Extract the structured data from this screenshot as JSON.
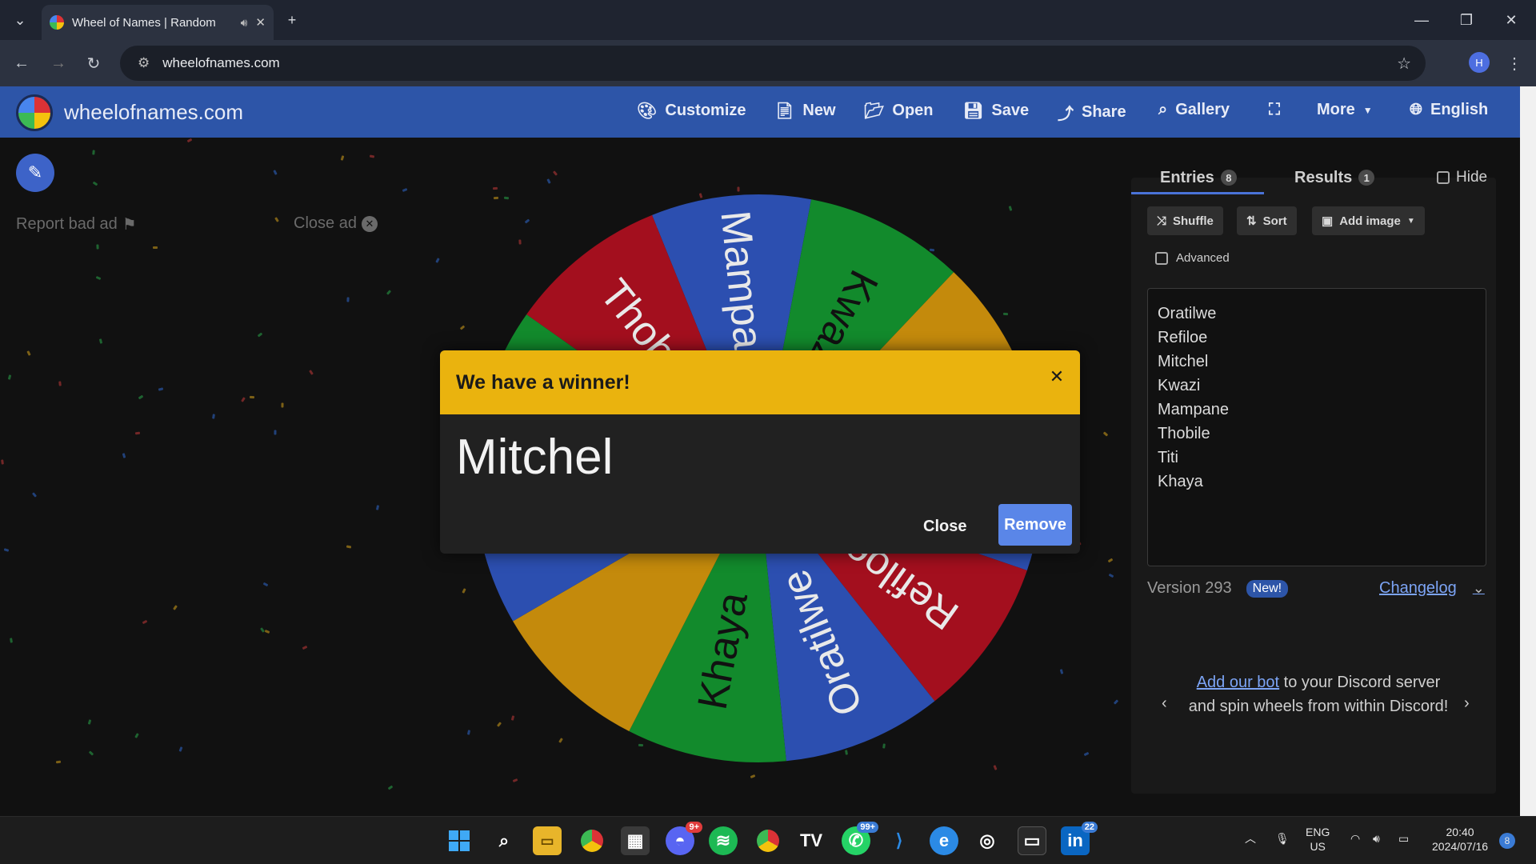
{
  "browser": {
    "tab_title": "Wheel of Names | Random",
    "url": "wheelofnames.com",
    "profile_initial": "H"
  },
  "app": {
    "brand": "wheelofnames.com",
    "menu": [
      {
        "label": "Customize",
        "icon": "palette-icon"
      },
      {
        "label": "New",
        "icon": "file-icon"
      },
      {
        "label": "Open",
        "icon": "folder-icon"
      },
      {
        "label": "Save",
        "icon": "floppy-icon"
      },
      {
        "label": "Share",
        "icon": "share-icon"
      },
      {
        "label": "Gallery",
        "icon": "search-icon"
      },
      {
        "label": "",
        "icon": "fullscreen-icon"
      },
      {
        "label": "More",
        "icon": "caret-down-icon"
      },
      {
        "label": "English",
        "icon": "globe-icon"
      }
    ]
  },
  "ad": {
    "report": "Report bad ad",
    "close": "Close ad"
  },
  "wheel": {
    "slices": [
      {
        "name": "Mampane",
        "color": "#2c4fb0"
      },
      {
        "name": "Kwazi",
        "color": "#128a2c"
      },
      {
        "name": "",
        "color": "#c48a0c"
      },
      {
        "name": "",
        "color": "#2c4fb0"
      },
      {
        "name": "Refiloe",
        "color": "#a30f1e"
      },
      {
        "name": "Oratilwe",
        "color": "#2c4fb0"
      },
      {
        "name": "Khaya",
        "color": "#128a2c"
      },
      {
        "name": "",
        "color": "#c48a0c"
      },
      {
        "name": "",
        "color": "#2c4fb0"
      },
      {
        "name": "",
        "color": "#128a2c"
      },
      {
        "name": "Thobile",
        "color": "#a30f1e"
      }
    ]
  },
  "panel": {
    "tabs": [
      {
        "label": "Entries",
        "count": "8"
      },
      {
        "label": "Results",
        "count": "1"
      }
    ],
    "hide_label": "Hide",
    "tools": [
      "Shuffle",
      "Sort",
      "Add image"
    ],
    "advanced_label": "Advanced",
    "entries": [
      "Oratilwe",
      "Refiloe",
      "Mitchel",
      "Kwazi",
      "Mampane",
      "Thobile",
      "Titi",
      "Khaya"
    ],
    "version": "Version 293",
    "new_badge": "New!",
    "changelog": "Changelog",
    "discord_link": "Add our bot",
    "discord_text": " to your Discord server and spin wheels from within Discord!"
  },
  "modal": {
    "title": "We have a winner!",
    "winner": "Mitchel",
    "close_label": "Close",
    "remove_label": "Remove"
  },
  "taskbar": {
    "badges": {
      "discord": "9+",
      "whatsapp": "99+",
      "linkedin": "22",
      "notifications": "8"
    },
    "lang": "ENG",
    "region": "US",
    "time": "20:40",
    "date": "2024/07/16"
  },
  "colors": {
    "appbar": "#2d55a8",
    "modal_header": "#eab30e",
    "remove_button": "#5a86e8"
  }
}
